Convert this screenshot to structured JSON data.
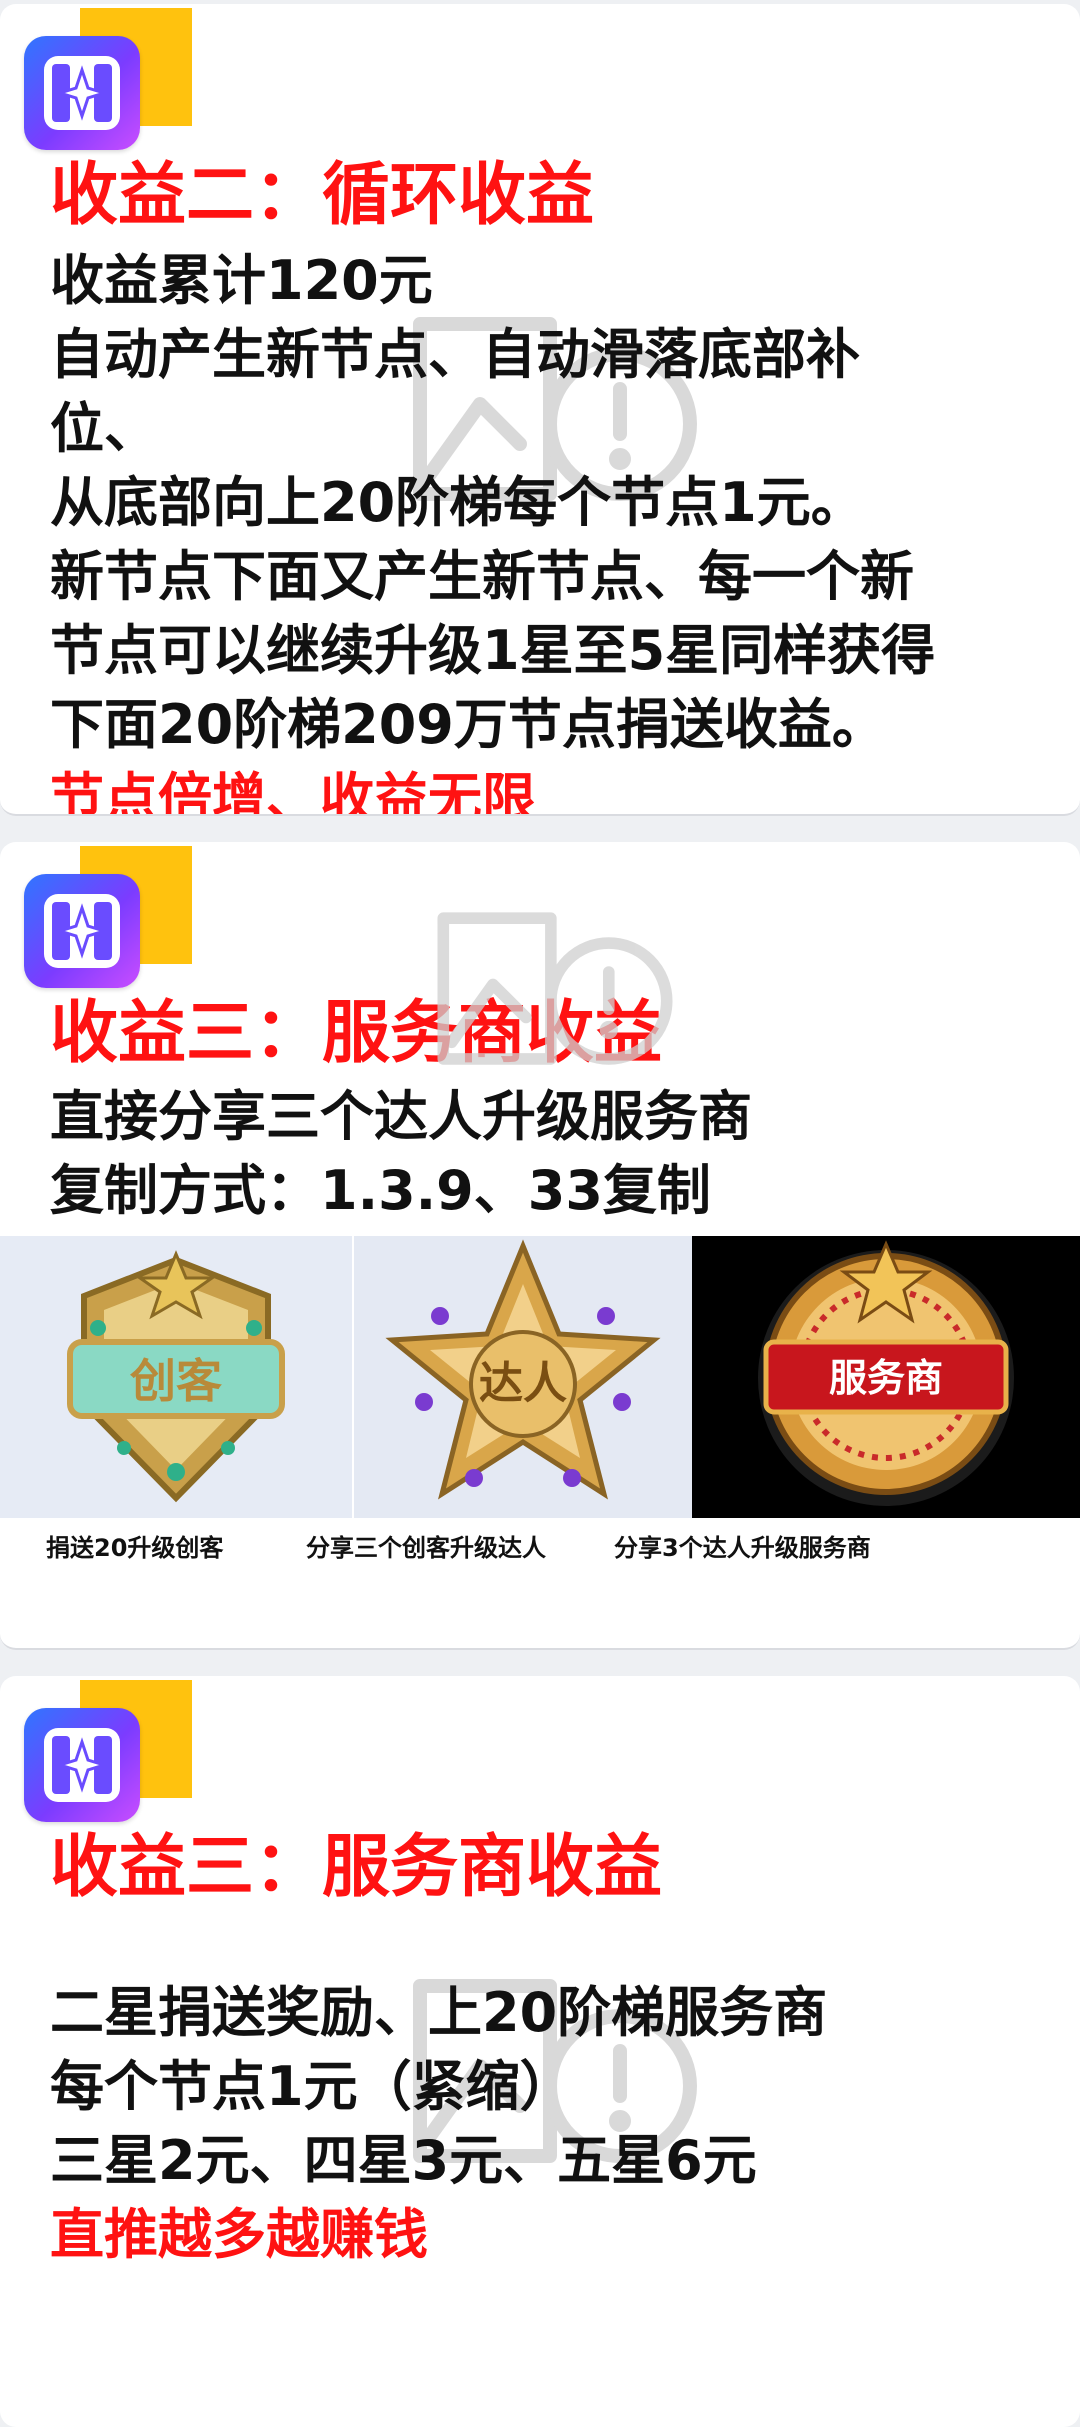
{
  "cards": [
    {
      "logo_icon": "sparkle-app-icon",
      "title": "收益二：循环收益",
      "lines": [
        "收益累计120元",
        "自动产生新节点、自动滑落底部补",
        "位、",
        "从底部向上20阶梯每个节点1元。",
        "新节点下面又产生新节点、每一个新",
        "节点可以继续升级1星至5星同样获得",
        "下面20阶梯209万节点捐送收益。"
      ],
      "highlight": "节点倍增、收益无限"
    },
    {
      "logo_icon": "sparkle-app-icon",
      "title": "收益三：服务商收益",
      "lines": [
        "直接分享三个达人升级服务商",
        "复制方式：1.3.9、33复制"
      ],
      "badges": [
        {
          "text": "创客",
          "caption": "捐送20升级创客",
          "icon": "chuangke-badge-icon"
        },
        {
          "text": "达人",
          "caption": "分享三个创客升级达人",
          "icon": "daren-star-badge-icon"
        },
        {
          "text": "服务商",
          "caption": "分享3个达人升级服务商",
          "icon": "fuwushang-medal-icon"
        }
      ]
    },
    {
      "logo_icon": "sparkle-app-icon",
      "title": "收益三：服务商收益",
      "lines": [
        "二星捐送奖励、上20阶梯服务商",
        "每个节点1元（紧缩）",
        "三星2元、四星3元、五星6元"
      ],
      "highlight": "直推越多越赚钱"
    }
  ],
  "colors": {
    "highlight": "#ff1212",
    "text": "#111111",
    "logo_yellow": "#ffc20e"
  },
  "watermark_icon": "image-placeholder-icon"
}
